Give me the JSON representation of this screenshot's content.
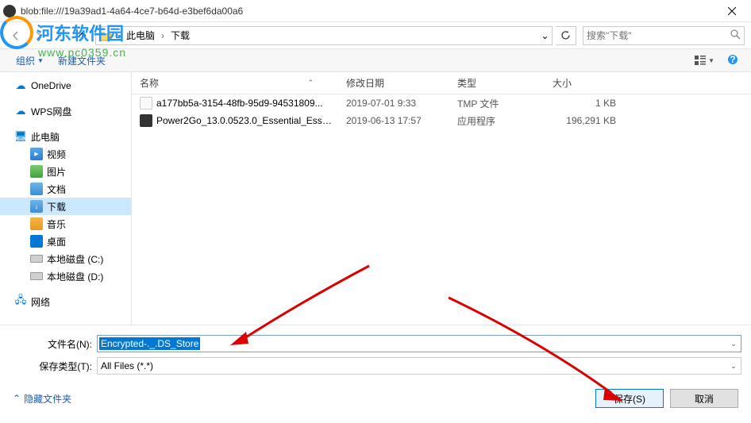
{
  "title": "blob:file:///19a39ad1-4a64-4ce7-b64d-e3bef6da00a6",
  "watermark": {
    "cn": "河东软件园",
    "url": "www.pc0359.cn"
  },
  "breadcrumb": {
    "node1": "此电脑",
    "node2": "下载"
  },
  "search": {
    "placeholder": "搜索\"下载\""
  },
  "toolbar": {
    "organize": "组织",
    "newfolder": "新建文件夹"
  },
  "sidebar": {
    "onedrive": "OneDrive",
    "wps": "WPS网盘",
    "thispc": "此电脑",
    "video": "视频",
    "pictures": "图片",
    "documents": "文档",
    "downloads": "下载",
    "music": "音乐",
    "desktop": "桌面",
    "diskc": "本地磁盘 (C:)",
    "diskd": "本地磁盘 (D:)",
    "network": "网络"
  },
  "columns": {
    "name": "名称",
    "date": "修改日期",
    "type": "类型",
    "size": "大小"
  },
  "files": [
    {
      "name": "a177bb5a-3154-48fb-95d9-94531809...",
      "date": "2019-07-01 9:33",
      "type": "TMP 文件",
      "size": "1 KB",
      "icon": "tmp"
    },
    {
      "name": "Power2Go_13.0.0523.0_Essential_Esse...",
      "date": "2019-06-13 17:57",
      "type": "应用程序",
      "size": "196,291 KB",
      "icon": "exe"
    }
  ],
  "filename": {
    "label": "文件名(N):",
    "value": "Encrypted-._.DS_Store"
  },
  "filetype": {
    "label": "保存类型(T):",
    "value": "All Files (*.*)"
  },
  "footer": {
    "hide": "隐藏文件夹",
    "save": "保存(S)",
    "cancel": "取消"
  }
}
